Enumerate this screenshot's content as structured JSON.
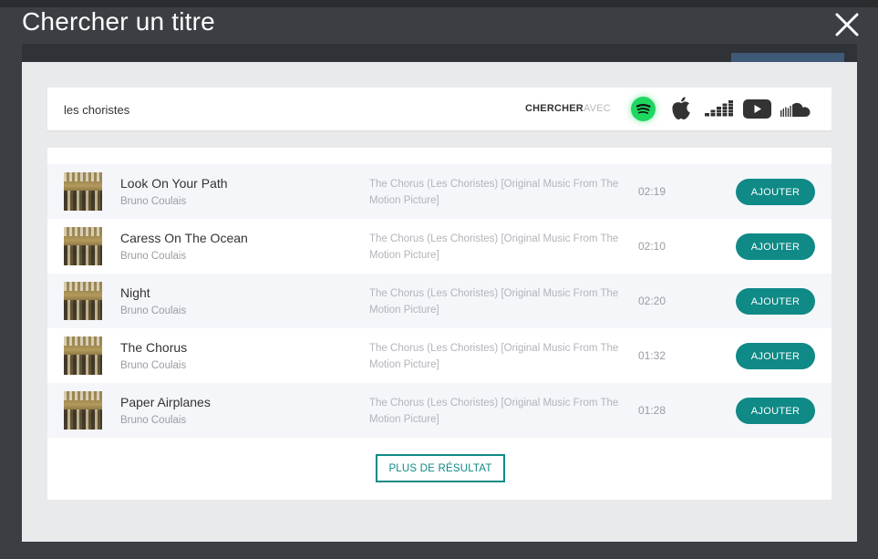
{
  "modal": {
    "title": "Chercher un titre"
  },
  "search": {
    "value": "les choristes",
    "with_strong": "CHERCHER",
    "with_light": "AVEC",
    "sources": [
      "spotify-icon",
      "apple-music-icon",
      "deezer-icon",
      "youtube-icon",
      "soundcloud-icon"
    ]
  },
  "results": [
    {
      "title": "Look On Your Path",
      "artist": "Bruno Coulais",
      "album": "The Chorus (Les Choristes) [Original Music From The Motion Picture]",
      "duration": "02:19",
      "action": "AJOUTER"
    },
    {
      "title": "Caress On The Ocean",
      "artist": "Bruno Coulais",
      "album": "The Chorus (Les Choristes) [Original Music From The Motion Picture]",
      "duration": "02:10",
      "action": "AJOUTER"
    },
    {
      "title": "Night",
      "artist": "Bruno Coulais",
      "album": "The Chorus (Les Choristes) [Original Music From The Motion Picture]",
      "duration": "02:20",
      "action": "AJOUTER"
    },
    {
      "title": "The Chorus",
      "artist": "Bruno Coulais",
      "album": "The Chorus (Les Choristes) [Original Music From The Motion Picture]",
      "duration": "01:32",
      "action": "AJOUTER"
    },
    {
      "title": "Paper Airplanes",
      "artist": "Bruno Coulais",
      "album": "The Chorus (Les Choristes) [Original Music From The Motion Picture]",
      "duration": "01:28",
      "action": "AJOUTER"
    }
  ],
  "more_label": "PLUS DE RÉSULTAT",
  "colors": {
    "accent": "#0f8a86",
    "spotify": "#1ed760"
  }
}
